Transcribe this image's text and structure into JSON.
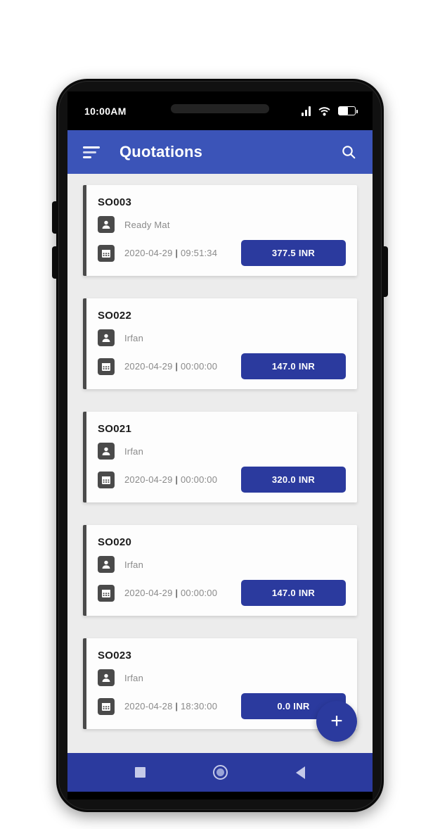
{
  "status_bar": {
    "time": "10:00AM",
    "icons": [
      "signal-icon",
      "wifi-icon",
      "battery-icon"
    ],
    "battery_level": "58"
  },
  "app_bar": {
    "menu_icon": "hamburger-menu-icon",
    "title": "Quotations",
    "search_icon": "search-icon",
    "background_color": "#3b54b8"
  },
  "theme": {
    "primary_blue": "#3b54b8",
    "accent_blue": "#2b3a9e",
    "page_background": "#ececec",
    "card_background": "#fdfdfd",
    "card_accent_bar": "#4a4a4a"
  },
  "list": {
    "person_icon": "person-icon",
    "calendar_icon": "calendar-icon",
    "items": [
      {
        "code": "SO003",
        "customer": "Ready Mat",
        "date": "2020-04-29",
        "separator": "|",
        "time": "09:51:34",
        "amount": "377.5 INR"
      },
      {
        "code": "SO022",
        "customer": "Irfan",
        "date": "2020-04-29",
        "separator": "|",
        "time": "00:00:00",
        "amount": "147.0 INR"
      },
      {
        "code": "SO021",
        "customer": "Irfan",
        "date": "2020-04-29",
        "separator": "|",
        "time": "00:00:00",
        "amount": "320.0 INR"
      },
      {
        "code": "SO020",
        "customer": "Irfan",
        "date": "2020-04-29",
        "separator": "|",
        "time": "00:00:00",
        "amount": "147.0 INR"
      },
      {
        "code": "SO023",
        "customer": "Irfan",
        "date": "2020-04-28",
        "separator": "|",
        "time": "18:30:00",
        "amount": "0.0 INR"
      }
    ]
  },
  "fab": {
    "label": "+",
    "icon": "plus-icon"
  },
  "nav_bar": {
    "recents_icon": "square-recents-icon",
    "home_icon": "circle-home-icon",
    "back_icon": "triangle-back-icon"
  }
}
